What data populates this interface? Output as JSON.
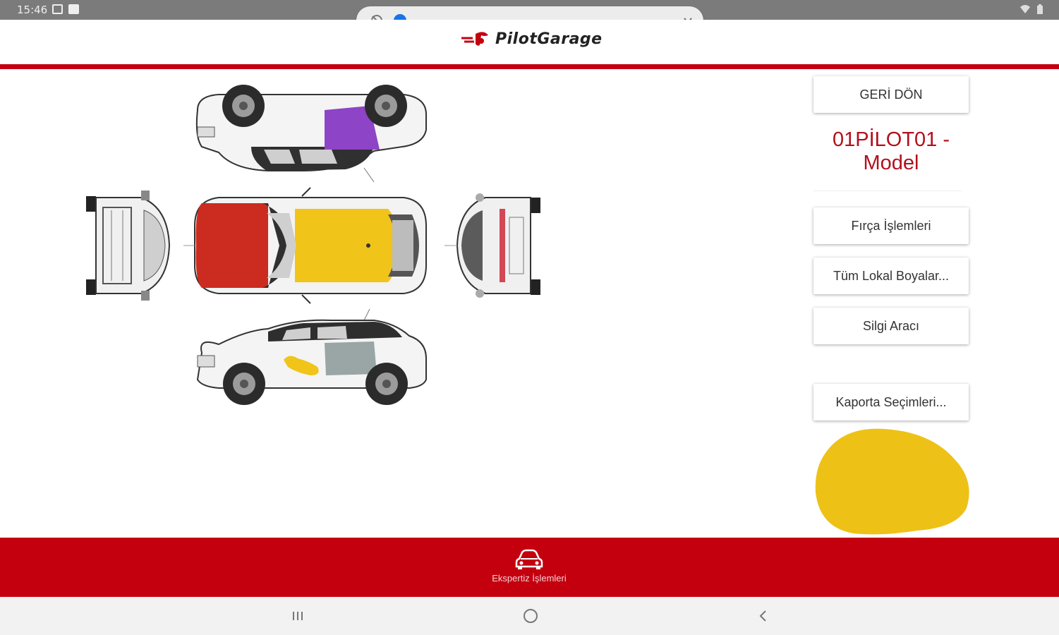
{
  "status_bar": {
    "time": "15:46"
  },
  "app": {
    "logo_text": "PilotGarage"
  },
  "media": {
    "progress": 0.0
  },
  "panel": {
    "back_label": "GERİ DÖN",
    "plate_line1": "01PİLOT01 -",
    "plate_line2": "Model",
    "brush_label": "Fırça İşlemleri",
    "local_paints_label": "Tüm Lokal Boyalar...",
    "eraser_label": "Silgi Aracı",
    "body_select_label": "Kaporta Seçimleri..."
  },
  "colors": {
    "brand_red": "#c4000f",
    "paint_red": "#cc2b1f",
    "paint_yellow": "#f0c419",
    "paint_purple": "#8e44c6",
    "paint_gray": "#9aa5a5",
    "selected_swatch": "#eec116"
  },
  "bottom_nav": {
    "label": "Ekspertiz İşlemleri",
    "icon": "car-icon"
  },
  "android_nav": {
    "recents": "recents-icon",
    "home": "home-icon",
    "back": "back-icon"
  }
}
